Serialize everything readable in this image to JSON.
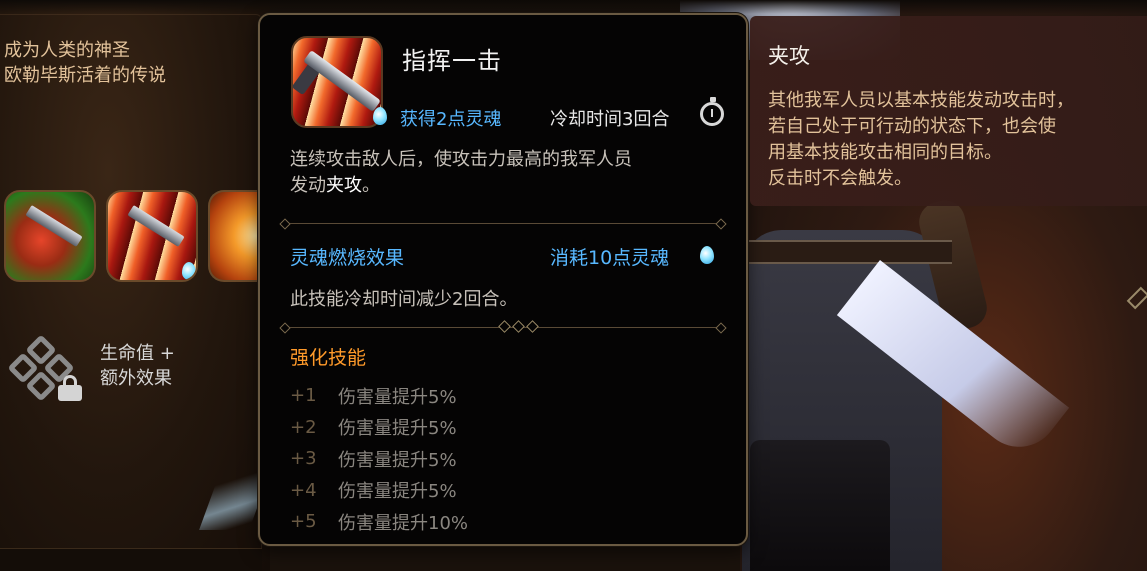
{
  "left_panel": {
    "bio_line1": "成为人类的神圣",
    "bio_line2": "欧勒毕斯活着的传说",
    "passive_line1": "生命值 +",
    "passive_line2": "额外效果"
  },
  "tooltip": {
    "skill_name": "指挥一击",
    "gain_soul": "获得2点灵魂",
    "cooldown": "冷却时间3回合",
    "desc_part1": "连续攻击敌人后，使攻击力最高的我军人员",
    "desc_part2": "发动",
    "desc_keyword": "夹攻",
    "desc_part3": "。",
    "soul_burn_title": "灵魂燃烧效果",
    "soul_burn_cost": "消耗10点灵魂",
    "soul_burn_desc": "此技能冷却时间减少2回合。",
    "enhance_title": "强化技能",
    "enhancements": [
      {
        "level": "+1",
        "text": "伤害量提升5%"
      },
      {
        "level": "+2",
        "text": "伤害量提升5%"
      },
      {
        "level": "+3",
        "text": "伤害量提升5%"
      },
      {
        "level": "+4",
        "text": "伤害量提升5%"
      },
      {
        "level": "+5",
        "text": "伤害量提升10%"
      }
    ]
  },
  "keyword_panel": {
    "title": "夹攻",
    "desc_line1": "其他我军人员以基本技能发动攻击时，",
    "desc_line2": "若自己处于可行动的状态下，也会使",
    "desc_line3": "用基本技能攻击相同的目标。",
    "desc_line4": "反击时不会触发。"
  },
  "icons": {
    "skill_icon": "sword-slash-icon",
    "soul": "soul-flame-icon",
    "timer": "stopwatch-icon",
    "lock": "lock-icon",
    "passive": "chain-links-icon"
  },
  "colors": {
    "soul_blue": "#58b8ff",
    "enhance_orange": "#ff9a2a",
    "lore_gold": "#e2c29a",
    "tooltip_border": "#6a5a42"
  }
}
